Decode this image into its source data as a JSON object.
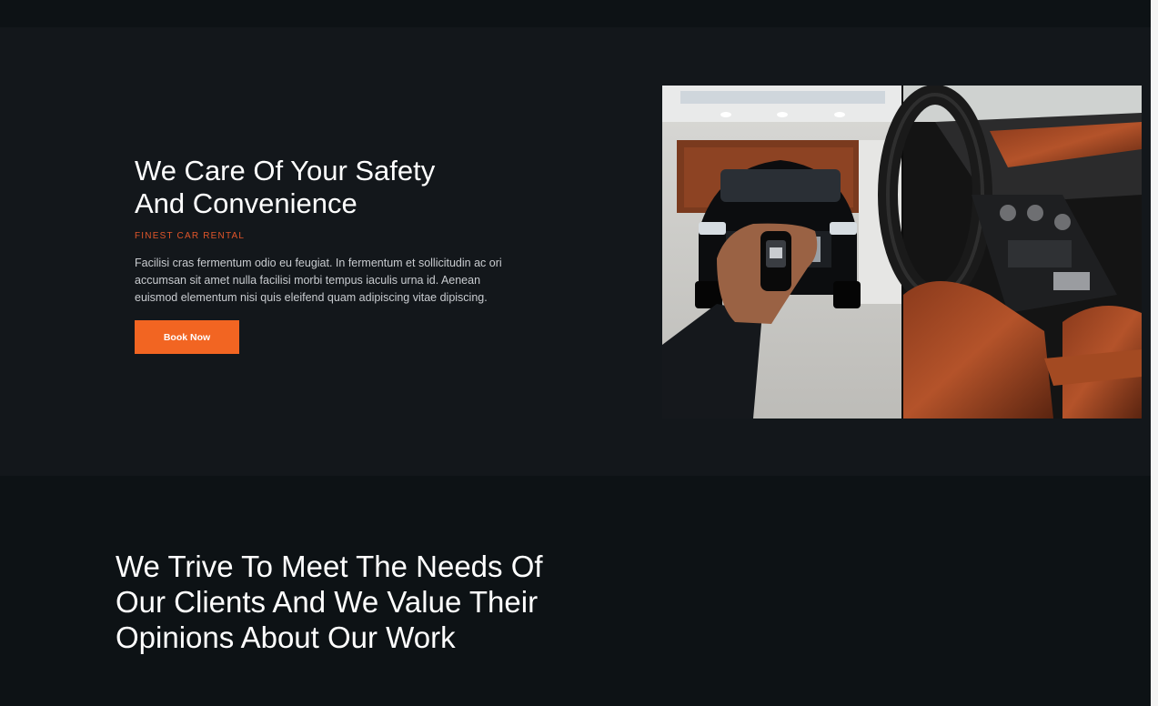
{
  "hero": {
    "title_line1": "We Care Of Your Safety",
    "title_line2": "And Convenience",
    "kicker": "FINEST CAR RENTAL",
    "body": "Facilisi cras fermentum odio eu feugiat. In fermentum et sollicitudin ac ori accumsan sit amet nulla facilisi morbi tempus iaculis urna id. Aenean euismod elementum nisi quis eleifend quam adipiscing vitae dipiscing.",
    "cta_label": "Book Now",
    "accent_color": "#f26522",
    "kicker_color": "#e0552a"
  },
  "gallery": {
    "left_image": "car-key-garage-photo",
    "right_image": "car-interior-photo"
  },
  "testimonials": {
    "title_line1": "We Trive To Meet The Needs Of",
    "title_line2": "Our Clients And We Value Their",
    "title_line3": "Opinions About Our Work"
  }
}
